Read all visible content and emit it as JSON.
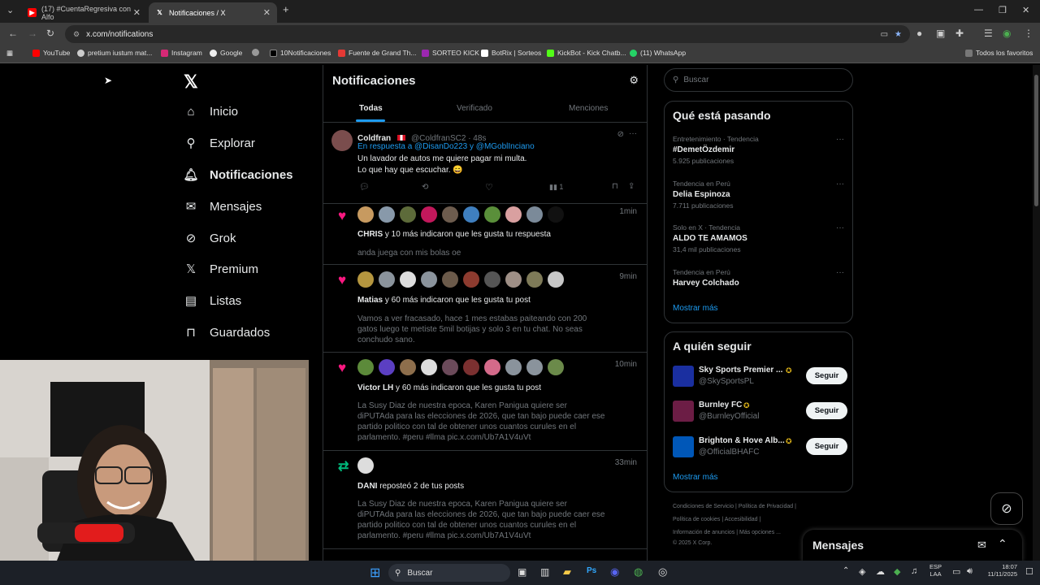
{
  "browser": {
    "tabs": [
      {
        "title": "(17) #CuentaRegresiva con Alfo",
        "active": false
      },
      {
        "title": "Notificaciones / X",
        "active": true
      }
    ],
    "url": "x.com/notifications",
    "bookmarks": [
      "YouTube",
      "pretium iustum mat...",
      "Instagram",
      "Google",
      "10Notificaciones",
      "Fuente de Grand Th...",
      "SORTEO KICK",
      "BotRix | Sorteos",
      "KickBot - Kick Chatb...",
      "(11) WhatsApp"
    ],
    "all_bookmarks": "Todos los favoritos"
  },
  "nav": {
    "items": [
      "Inicio",
      "Explorar",
      "Notificaciones",
      "Mensajes",
      "Grok",
      "Premium",
      "Listas",
      "Guardados"
    ]
  },
  "notifications": {
    "title": "Notificaciones",
    "tabs": [
      "Todas",
      "Verificado",
      "Menciones"
    ],
    "reply": {
      "name": "Coldfran",
      "handle": "@ColdfranSC2 · 48s",
      "reply_to": "En respuesta a @DisanDo223 y @MGoblInciano",
      "text1": "Un lavador de autos me quiere pagar mi multa.",
      "text2": "Lo que hay que escuchar. 😄",
      "views": "1"
    },
    "items": [
      {
        "time": "1min",
        "who": "CHRIS",
        "rest": " y 10 más indicaron que les gusta tu respuesta",
        "snippet": "anda juega con mis bolas oe"
      },
      {
        "time": "9min",
        "who": "Matias",
        "rest": " y 60 más indicaron que les gusta tu post",
        "snippet": "Vamos a ver fracasado, hace 1 mes estabas paiteando con 200 gatos luego te metiste 5mil botijas y solo 3 en tu chat. No seas conchudo sano."
      },
      {
        "time": "10min",
        "who": "Victor LH",
        "rest": " y 60 más indicaron que les gusta tu post",
        "snippet": "La Susy Diaz de nuestra epoca, Karen Panigua quiere ser diPUTAda para las elecciones de 2026, que tan bajo puede caer ese partido politico con tal de obtener unos cuantos curules en el parlamento. #peru #llma pic.x.com/Ub7A1V4uVt"
      },
      {
        "time": "33min",
        "who": "DANI",
        "rest": " reposteó 2 de tus posts",
        "snippet": "La Susy Diaz de nuestra epoca, Karen Panigua quiere ser diPUTAda para las elecciones de 2026, que tan bajo puede caer ese partido politico con tal de obtener unos cuantos curules en el parlamento. #peru #llma pic.x.com/Ub7A1V4uVt"
      }
    ]
  },
  "right": {
    "search_placeholder": "Buscar",
    "trending_title": "Qué está pasando",
    "trends": [
      {
        "cat": "Entretenimiento · Tendencia",
        "name": "#DemetÖzdemir",
        "count": "5.925 publicaciones"
      },
      {
        "cat": "Tendencia en Perú",
        "name": "Delia Espinoza",
        "count": "7.711 publicaciones"
      },
      {
        "cat": "Solo en X · Tendencia",
        "name": "ALDO TE AMAMOS",
        "count": "31,4 mil publicaciones"
      },
      {
        "cat": "Tendencia en Perú",
        "name": "Harvey Colchado",
        "count": ""
      }
    ],
    "show_more": "Mostrar más",
    "follow_title": "A quién seguir",
    "follow": [
      {
        "name": "Sky Sports Premier ...",
        "handle": "@SkySportsPL",
        "btn": "Seguir",
        "color": "#1a2fa0"
      },
      {
        "name": "Burnley FC",
        "handle": "@BurnleyOfficial",
        "btn": "Seguir",
        "color": "#6c1d45"
      },
      {
        "name": "Brighton & Hove Alb...",
        "handle": "@OfficialBHAFC",
        "btn": "Seguir",
        "color": "#0057b8"
      }
    ],
    "footer": [
      "Condiciones de Servicio",
      "Política de Privacidad",
      "Política de cookies",
      "Accesibilidad",
      "Información de anuncios",
      "Más opciones ...",
      "© 2025 X Corp."
    ],
    "messages": "Mensajes"
  },
  "taskbar": {
    "search": "Buscar",
    "lang1": "ESP",
    "lang2": "LAA",
    "time": "18:07",
    "date": "11/11/2025"
  }
}
